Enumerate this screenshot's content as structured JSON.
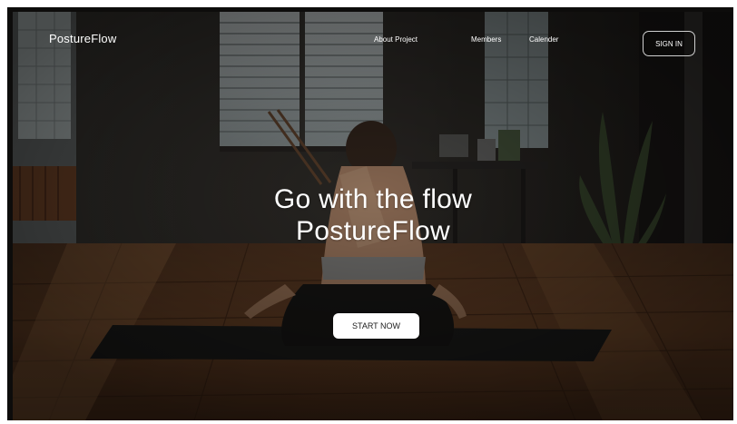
{
  "nav": {
    "brand": "PostureFlow",
    "links": [
      "About Project",
      "Members",
      "Calender"
    ],
    "signin_label": "SIGN IN"
  },
  "hero": {
    "line1": "Go with the flow",
    "line2": "PostureFlow",
    "cta_label": "START NOW"
  },
  "colors": {
    "text": "#ffffff",
    "cta_bg": "#ffffff",
    "cta_text": "#1c1c1c",
    "frame": "#0d0c0b"
  },
  "background_image": "yoga-studio-photo"
}
